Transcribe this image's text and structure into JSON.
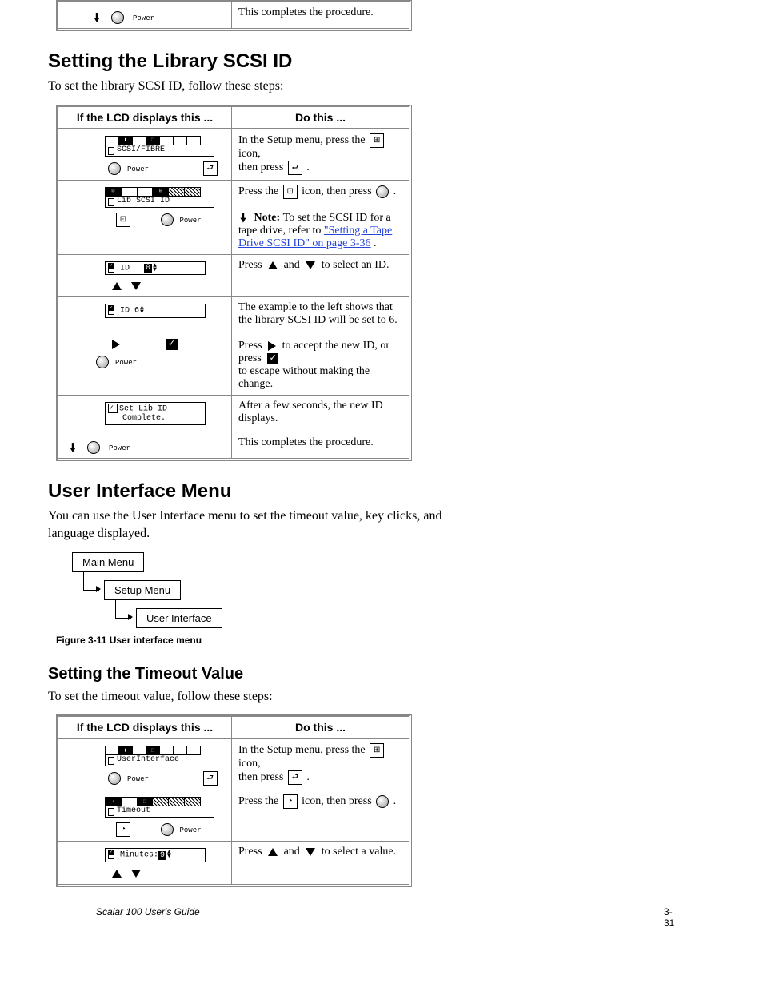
{
  "section2": {
    "title": "Setting the Library SCSI ID",
    "intro": "To set the library SCSI ID, follow these steps:",
    "table_caption": "",
    "header_left": "If the LCD displays this ...",
    "header_right": "Do this ..."
  },
  "t1_last_left_label": "Power",
  "t1_last_right": "This completes the procedure.",
  "set_scsi": {
    "r1": {
      "lcd_bar_label": "SCSI/FIBRE",
      "txt1": "In the Setup menu, press the",
      "txt2": " icon,",
      "txt3": "then press ",
      "txt4": "."
    },
    "r2": {
      "lcd_bar_label": "Lib SCSI ID",
      "txt1": "Press the ",
      "txt2": " icon, then press ",
      "txt3": ".",
      "note_lead": "Note: ",
      "note_body": "To set the SCSI ID for a tape drive, refer to ",
      "note_link": "\"Setting a Tape Drive SCSI ID\" on page 3-36",
      "note_after": "."
    },
    "r3": {
      "lcd_value": "ID",
      "lcd_field": "0",
      "txt1": "Press ",
      "txt2": " and ",
      "txt3": " to select an ID."
    },
    "r4": {
      "lcd_value": "ID    6",
      "txt1": "The example to the left shows that the library SCSI ID will be set to 6.",
      "txt2a": "Press ",
      "txt2b": " to accept the new ID, or press ",
      "txt3": " to escape without making the change."
    },
    "r5": {
      "lcd_line1": "Set Lib ID",
      "lcd_line2": "Complete.",
      "txt1": "After a few seconds, the new ID displays."
    },
    "foot_left_label": "Power",
    "foot_right": "This completes the procedure."
  },
  "section3": {
    "title": "User Interface Menu",
    "intro1": "You can use the User Interface menu to set the timeout value, key clicks, and\nlanguage displayed.",
    "diagram": {
      "l1": "Main Menu",
      "l2": "Setup Menu",
      "l3": "User Interface"
    },
    "figcap": "Figure 3-11   User interface menu",
    "sub_title": "Setting the Timeout Value",
    "sub_intro": "To set the timeout value, follow these steps:",
    "header_left": "If the LCD displays this ...",
    "header_right": "Do this ..."
  },
  "set_timeout": {
    "r1": {
      "lcd_bar_label": "UserInterface",
      "txt1": "In the Setup menu, press the",
      "txt2": " icon,",
      "txt3": "then press ",
      "txt4": "."
    },
    "r2": {
      "lcd_bar_label": "Timeout",
      "txt1": "Press the ",
      "txt2": " icon, then press ",
      "txt3": "."
    },
    "r3": {
      "lcd_value": "Minutes:",
      "lcd_field": "9",
      "txt1": "Press ",
      "txt2": " and ",
      "txt3": " to select a value."
    }
  },
  "footer": {
    "title": "Scalar 100 User's Guide",
    "page": "3-31"
  }
}
